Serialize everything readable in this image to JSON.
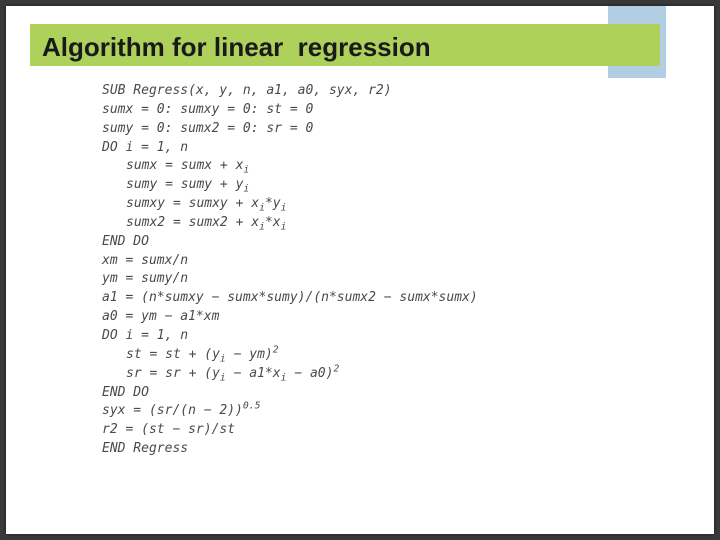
{
  "title": "Algorithm for linear  regression",
  "code": {
    "l01": "SUB Regress(x, y, n, a1, a0, syx, r2)",
    "l02a": "sumx = 0: sumxy = 0: st = 0",
    "l02b": "sumy = 0: sumx2 = 0: sr = 0",
    "l03": "DO i = 1, n",
    "l04a": "sumx = sumx + x",
    "l04a_sub": "i",
    "l04b": "sumy = sumy + y",
    "l04b_sub": "i",
    "l04c_pre": "sumxy = sumxy + x",
    "l04c_sub1": "i",
    "l04c_mid": "*y",
    "l04c_sub2": "i",
    "l04d_pre": "sumx2 = sumx2 + x",
    "l04d_sub1": "i",
    "l04d_mid": "*x",
    "l04d_sub2": "i",
    "l05": "END DO",
    "l06": "xm = sumx/n",
    "l07": "ym = sumy/n",
    "l08": "a1 = (n*sumxy − sumx*sumy)/(n*sumx2 − sumx*sumx)",
    "l09": "a0 = ym − a1*xm",
    "l10": "DO i = 1, n",
    "l11_pre": "st = st + (y",
    "l11_sub": "i",
    "l11_post": " − ym)",
    "l11_sup": "2",
    "l12_pre": "sr = sr + (y",
    "l12_sub1": "i",
    "l12_mid": " − a1*x",
    "l12_sub2": "i",
    "l12_post": " − a0)",
    "l12_sup": "2",
    "l13": "END DO",
    "l14_pre": "syx = (sr/(n − 2))",
    "l14_sup": "0.5",
    "l15": "r2 = (st − sr)/st",
    "l16": "END Regress"
  }
}
